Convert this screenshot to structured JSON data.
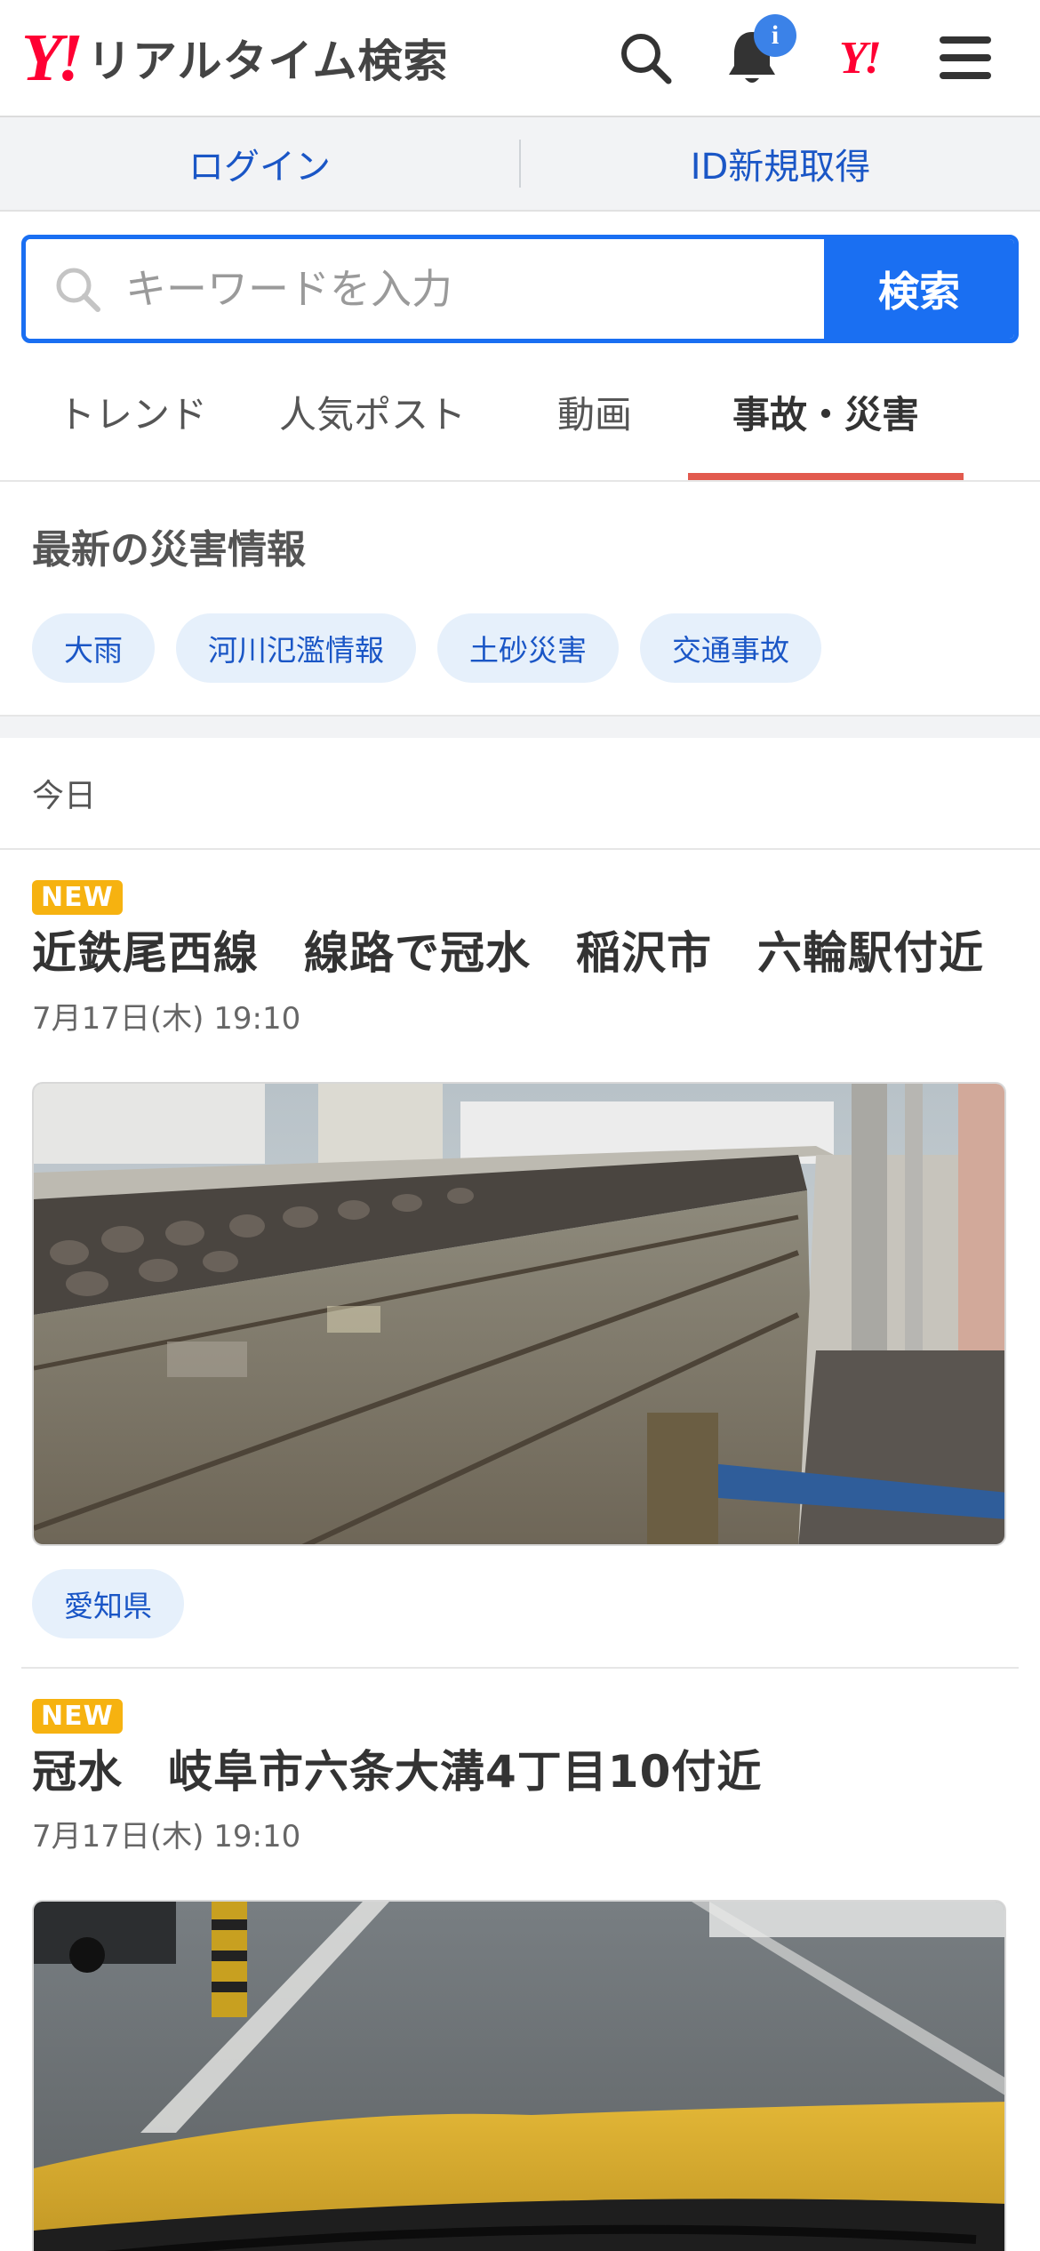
{
  "header": {
    "logo_mark": "Y!",
    "logo_text": "リアルタイム検索",
    "notification_badge": "i",
    "yahoo_mark": "Y!"
  },
  "account": {
    "login": "ログイン",
    "signup": "ID新規取得"
  },
  "search": {
    "placeholder": "キーワードを入力",
    "button": "検索"
  },
  "tabs": [
    {
      "label": "トレンド",
      "active": false
    },
    {
      "label": "人気ポスト",
      "active": false
    },
    {
      "label": "動画",
      "active": false
    },
    {
      "label": "事故・災害",
      "active": true
    }
  ],
  "disaster": {
    "heading": "最新の災害情報",
    "chips": [
      "大雨",
      "河川氾濫情報",
      "土砂災害",
      "交通事故"
    ]
  },
  "day_heading": "今日",
  "articles": [
    {
      "badge": "NEW",
      "title": "近鉄尾西線　線路で冠水　稲沢市　六輪駅付近",
      "time": "7月17日(木) 19:10",
      "tag": "愛知県"
    },
    {
      "badge": "NEW",
      "title": "冠水　岐阜市六条大溝4丁目10付近",
      "time": "7月17日(木) 19:10"
    }
  ],
  "colors": {
    "accent": "#1a6ff2",
    "brand_red": "#ff0033",
    "tab_underline": "#e25a4e",
    "new_badge": "#f6b210"
  }
}
